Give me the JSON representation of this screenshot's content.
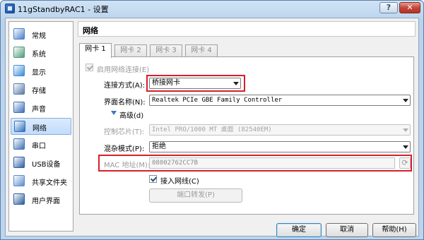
{
  "window": {
    "title": "11gStandbyRAC1 - 设置",
    "help_label": "?",
    "close_label": "✕"
  },
  "sidebar": {
    "items": [
      {
        "label": "常规",
        "icon": "general-icon",
        "color": "#4a7fc8"
      },
      {
        "label": "系统",
        "icon": "system-icon",
        "color": "#4f9b7a"
      },
      {
        "label": "显示",
        "icon": "display-icon",
        "color": "#3a8bd6"
      },
      {
        "label": "存储",
        "icon": "storage-icon",
        "color": "#5a7aa8"
      },
      {
        "label": "声音",
        "icon": "sound-icon",
        "color": "#3d6fb8"
      },
      {
        "label": "网络",
        "icon": "network-icon",
        "color": "#2f6fbd",
        "selected": true
      },
      {
        "label": "串口",
        "icon": "serial-port-icon",
        "color": "#3f73b5"
      },
      {
        "label": "USB设备",
        "icon": "usb-icon",
        "color": "#2e5fa6"
      },
      {
        "label": "共享文件夹",
        "icon": "shared-folder-icon",
        "color": "#5b8ccf"
      },
      {
        "label": "用户界面",
        "icon": "user-interface-icon",
        "color": "#2c5b9c"
      }
    ]
  },
  "header": {
    "title": "网络"
  },
  "tabs": [
    {
      "label": "网卡 1",
      "active": true
    },
    {
      "label": "网卡 2",
      "active": false
    },
    {
      "label": "网卡 3",
      "active": false
    },
    {
      "label": "网卡 4",
      "active": false
    }
  ],
  "adapter": {
    "enable_label": "启用网络连接(E)",
    "attached_label": "连接方式(A):",
    "attached_value": "桥接网卡",
    "name_label": "界面名称(N):",
    "name_value": "Realtek PCIe GBE Family Controller",
    "advanced_label": "高级(d)",
    "chip_label": "控制芯片(T):",
    "chip_value": "Intel PRO/1000 MT 桌面 (82540EM)",
    "promisc_label": "混杂模式(P):",
    "promisc_value": "拒绝",
    "mac_label": "MAC 地址(M):",
    "mac_value": "08002762CC7B",
    "cable_label": "接入网线(C)",
    "port_forward_label": "端口转发(P)"
  },
  "buttons": {
    "ok": "确定",
    "cancel": "取消",
    "help": "帮助(H)"
  },
  "colors": {
    "highlight": "#d6202a",
    "accent": "#3c78c3"
  }
}
